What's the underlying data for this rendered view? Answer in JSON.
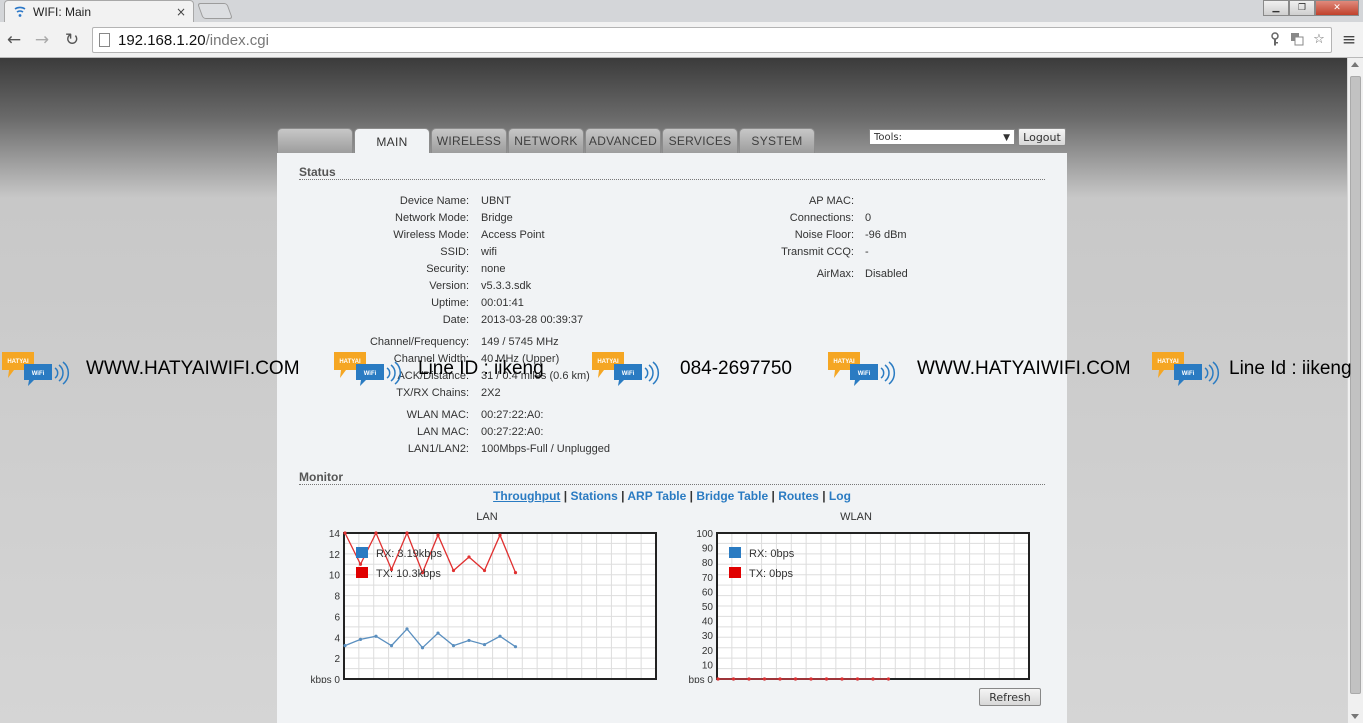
{
  "browser": {
    "tab_title": "WIFI: Main",
    "tab_close": "×",
    "url_host": "192.168.1.20",
    "url_path": "/index.cgi",
    "back_glyph": "←",
    "forward_glyph": "→",
    "reload_glyph": "↻",
    "menu_glyph": "≡",
    "icons": [
      "key-icon",
      "translate-icon",
      "star-icon"
    ]
  },
  "airos": {
    "tabs": [
      {
        "label": "MAIN",
        "active": true
      },
      {
        "label": "WIRELESS",
        "active": false
      },
      {
        "label": "NETWORK",
        "active": false
      },
      {
        "label": "ADVANCED",
        "active": false
      },
      {
        "label": "SERVICES",
        "active": false
      },
      {
        "label": "SYSTEM",
        "active": false
      }
    ],
    "tools_label": "Tools:",
    "tools_arrow": "▼",
    "logout_label": "Logout",
    "status_title": "Status",
    "monitor_title": "Monitor",
    "status_left": [
      {
        "label": "Device Name:",
        "value": "UBNT"
      },
      {
        "label": "Network Mode:",
        "value": "Bridge"
      },
      {
        "label": "Wireless Mode:",
        "value": "Access Point"
      },
      {
        "label": "SSID:",
        "value": "wifi"
      },
      {
        "label": "Security:",
        "value": "none"
      },
      {
        "label": "Version:",
        "value": "v5.3.3.sdk"
      },
      {
        "label": "Uptime:",
        "value": "00:01:41"
      },
      {
        "label": "Date:",
        "value": "2013-03-28 00:39:37"
      }
    ],
    "status_left2": [
      {
        "label": "Channel/Frequency:",
        "value": "149 / 5745 MHz"
      },
      {
        "label": "Channel Width:",
        "value": "40 MHz (Upper)"
      },
      {
        "label": "ACK/Distance:",
        "value": "31 / 0.4 miles (0.6 km)"
      },
      {
        "label": "TX/RX Chains:",
        "value": "2X2"
      }
    ],
    "status_left3": [
      {
        "label": "WLAN MAC:",
        "value": "00:27:22:A0:"
      },
      {
        "label": "LAN MAC:",
        "value": "00:27:22:A0:"
      },
      {
        "label": "LAN1/LAN2:",
        "value": "100Mbps-Full / Unplugged"
      }
    ],
    "status_right": [
      {
        "label": "AP MAC:",
        "value": ""
      },
      {
        "label": "Connections:",
        "value": "0"
      },
      {
        "label": "Noise Floor:",
        "value": "-96 dBm"
      },
      {
        "label": "Transmit CCQ:",
        "value": "-"
      },
      {
        "label": "AirMax:",
        "value": "Disabled"
      }
    ],
    "monitor_links": [
      "Throughput",
      "Stations",
      "ARP Table",
      "Bridge Table",
      "Routes",
      "Log"
    ],
    "monitor_sep": "|",
    "refresh_label": "Refresh"
  },
  "watermark": {
    "items": [
      "WWW.HATYAIWIFI.COM",
      "Line ID : iikeng",
      "084-2697750",
      "WWW.HATYAIWIFI.COM",
      "Line Id : iikeng"
    ],
    "logo_text": "HATYAI",
    "logo_sub": "WiFi"
  },
  "chart_data": [
    {
      "type": "line",
      "title": "LAN",
      "ylabel": "kbps",
      "ylim": [
        0,
        14
      ],
      "yticks": [
        0,
        2,
        4,
        6,
        8,
        10,
        12,
        14
      ],
      "legend": [
        {
          "name": "RX: 3.19kbps",
          "color": "#2a7bc2"
        },
        {
          "name": "TX: 10.3kbps",
          "color": "#e00000"
        }
      ],
      "series": [
        {
          "name": "RX: 3.19kbps",
          "color": "#5a8fbf",
          "values": [
            3.2,
            3.8,
            4.1,
            3.2,
            4.8,
            3.0,
            4.4,
            3.2,
            3.7,
            3.3,
            4.1,
            3.1
          ]
        },
        {
          "name": "TX: 10.3kbps",
          "color": "#e03030",
          "values": [
            14,
            11,
            14,
            10.5,
            14,
            10.2,
            13.8,
            10.4,
            11.7,
            10.4,
            13.8,
            10.2
          ]
        }
      ]
    },
    {
      "type": "line",
      "title": "WLAN",
      "ylabel": "bps",
      "ylim": [
        0,
        100
      ],
      "yticks": [
        0,
        10,
        20,
        30,
        40,
        50,
        60,
        70,
        80,
        90,
        100
      ],
      "legend": [
        {
          "name": "RX: 0bps",
          "color": "#2a7bc2"
        },
        {
          "name": "TX: 0bps",
          "color": "#e00000"
        }
      ],
      "series": [
        {
          "name": "RX: 0bps",
          "color": "#5a8fbf",
          "values": [
            0,
            0,
            0,
            0,
            0,
            0,
            0,
            0,
            0,
            0,
            0,
            0
          ]
        },
        {
          "name": "TX: 0bps",
          "color": "#e03030",
          "values": [
            0,
            0,
            0,
            0,
            0,
            0,
            0,
            0,
            0,
            0,
            0,
            0
          ]
        }
      ]
    }
  ]
}
